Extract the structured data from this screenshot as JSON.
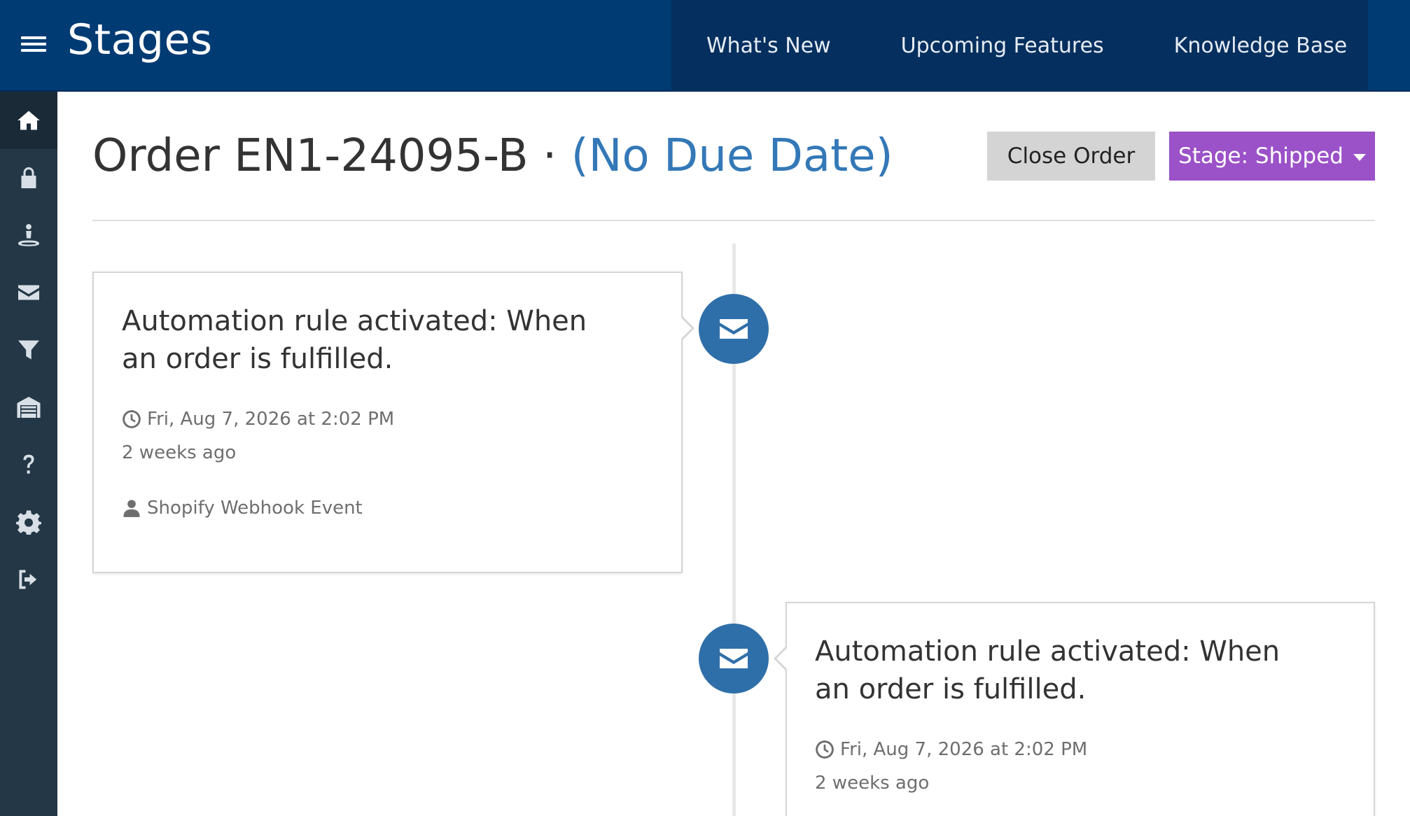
{
  "app": {
    "title": "Stages",
    "nav": [
      {
        "label": "What's New"
      },
      {
        "label": "Upcoming Features"
      },
      {
        "label": "Knowledge Base"
      }
    ]
  },
  "sidebar": {
    "items": [
      {
        "icon": "home-icon",
        "active": true
      },
      {
        "icon": "lock-icon",
        "active": false
      },
      {
        "icon": "user-stand-icon",
        "active": false
      },
      {
        "icon": "envelope-icon",
        "active": false
      },
      {
        "icon": "filter-icon",
        "active": false
      },
      {
        "icon": "warehouse-icon",
        "active": false
      },
      {
        "icon": "question-icon",
        "active": false
      },
      {
        "icon": "gear-icon",
        "active": false
      },
      {
        "icon": "sign-out-icon",
        "active": false
      }
    ]
  },
  "header": {
    "order_label": "Order EN1-24095-B",
    "separator": " · ",
    "due_date": "(No Due Date)",
    "close_button": "Close Order",
    "stage_button": "Stage: Shipped"
  },
  "colors": {
    "navbar": "#003b73",
    "sidebar": "#243746",
    "accent_link": "#3478b7",
    "stage_button": "#9b51c7",
    "timeline_node": "#2f6fa9"
  },
  "timeline": [
    {
      "title": "Automation rule activated: When an order is fulfilled.",
      "datetime": "Fri, Aug 7, 2026 at 2:02 PM",
      "relative": "2 weeks ago",
      "source": "Shopify Webhook Event",
      "icon": "envelope-icon"
    },
    {
      "title": "Automation rule activated: When an order is fulfilled.",
      "datetime": "Fri, Aug 7, 2026 at 2:02 PM",
      "relative": "2 weeks ago",
      "icon": "envelope-icon"
    }
  ]
}
